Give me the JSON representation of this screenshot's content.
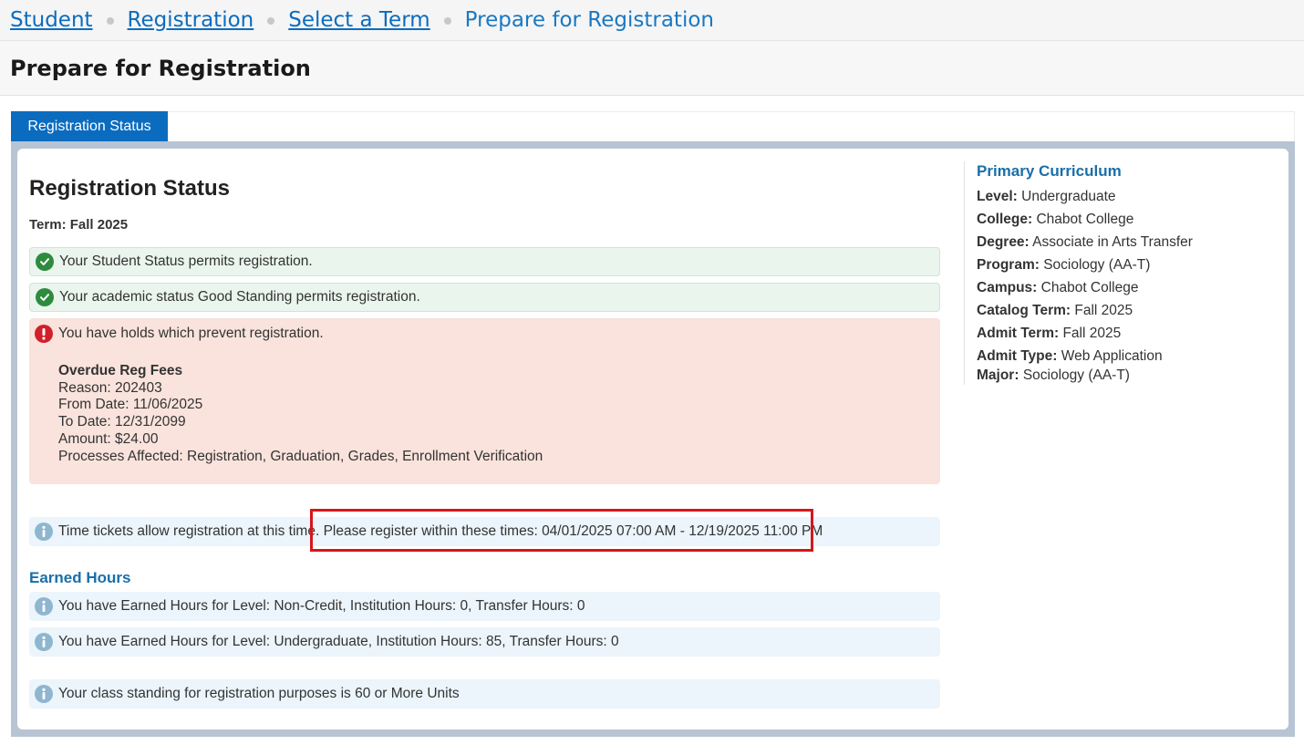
{
  "breadcrumb": {
    "items": [
      "Student",
      "Registration",
      "Select a Term"
    ],
    "current": "Prepare for Registration"
  },
  "page_title": "Prepare for Registration",
  "tabs": [
    {
      "label": "Registration Status",
      "active": true
    }
  ],
  "status": {
    "heading": "Registration Status",
    "term": "Term: Fall 2025",
    "messages": {
      "student_status": "Your Student Status permits registration.",
      "academic_status": "Your academic status Good Standing permits registration.",
      "holds": {
        "text": "You have holds which prevent registration.",
        "hold_name": "Overdue Reg Fees",
        "reason": "Reason: 202403",
        "from_date": "From Date: 11/06/2025",
        "to_date": "To Date: 12/31/2099",
        "amount": "Amount: $24.00",
        "processes": "Processes Affected: Registration, Graduation, Grades, Enrollment Verification"
      },
      "time_ticket": "Time tickets allow registration at this time. Please register within these times: 04/01/2025 07:00 AM - 12/19/2025 11:00 PM"
    },
    "earned_hours": {
      "heading": "Earned Hours",
      "items": [
        "You have Earned Hours for Level: Non-Credit, Institution Hours: 0, Transfer Hours: 0",
        "You have Earned Hours for Level: Undergraduate, Institution Hours: 85, Transfer Hours: 0"
      ]
    },
    "class_standing": "Your class standing for registration purposes is 60 or More Units"
  },
  "curriculum": {
    "heading": "Primary Curriculum",
    "fields": [
      {
        "label": "Level:",
        "value": "Undergraduate"
      },
      {
        "label": "College:",
        "value": "Chabot College"
      },
      {
        "label": "Degree:",
        "value": "Associate in Arts Transfer"
      },
      {
        "label": "Program:",
        "value": "Sociology (AA-T)"
      },
      {
        "label": "Campus:",
        "value": "Chabot College"
      },
      {
        "label": "Catalog Term:",
        "value": "Fall 2025"
      },
      {
        "label": "Admit Term:",
        "value": "Fall 2025"
      },
      {
        "label": "Admit Type:",
        "value": "Web Application"
      },
      {
        "label": "Major:",
        "value": "Sociology (AA-T)"
      }
    ]
  },
  "colors": {
    "link": "#0b6cbf",
    "tab_active": "#0b6cbf",
    "success_bg": "#eaf5ee",
    "error_bg": "#f9e3dc",
    "info_bg": "#ebf5fb",
    "highlight": "#d7161c"
  },
  "icons": {
    "success": "check-circle-icon",
    "error": "exclamation-circle-icon",
    "info": "info-circle-icon"
  }
}
